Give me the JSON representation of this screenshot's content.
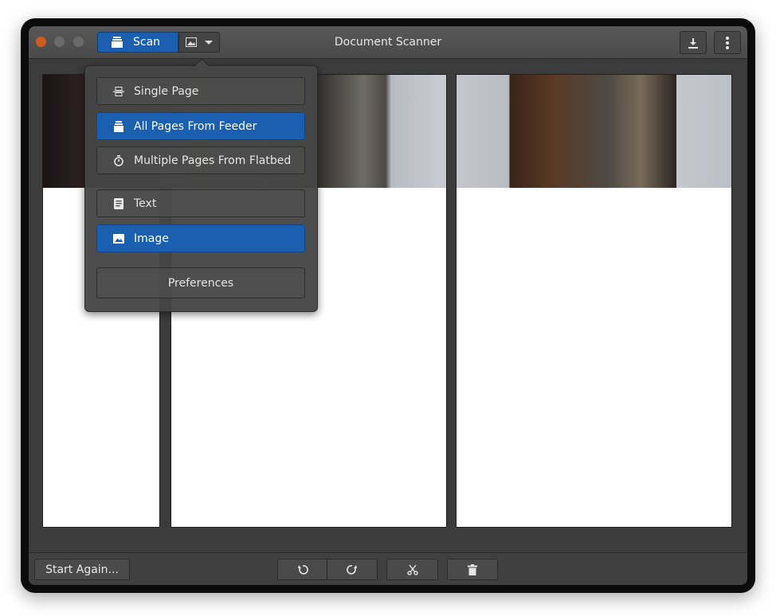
{
  "window": {
    "title": "Document Scanner"
  },
  "header": {
    "scan_label": "Scan",
    "scan_icon": "scanner-feeder-icon",
    "type_icon": "image-icon",
    "save_icon": "download-icon",
    "menu_icon": "kebab-menu-icon"
  },
  "scan_menu": {
    "items": [
      {
        "label": "Single Page",
        "icon": "single-page-icon",
        "selected": false
      },
      {
        "label": "All Pages From Feeder",
        "icon": "feeder-icon",
        "selected": true
      },
      {
        "label": "Multiple Pages From Flatbed",
        "icon": "timer-icon",
        "selected": false
      }
    ],
    "types": [
      {
        "label": "Text",
        "icon": "text-doc-icon",
        "selected": false
      },
      {
        "label": "Image",
        "icon": "image-icon",
        "selected": true
      }
    ],
    "preferences_label": "Preferences"
  },
  "footer": {
    "start_again_label": "Start Again...",
    "rotate_left_icon": "rotate-left-icon",
    "rotate_right_icon": "rotate-right-icon",
    "crop_icon": "crop-icon",
    "delete_icon": "trash-icon"
  },
  "colors": {
    "accent": "#1a5fb0",
    "close_button": "#d25a1b",
    "window_bg": "#3b3b3b"
  }
}
